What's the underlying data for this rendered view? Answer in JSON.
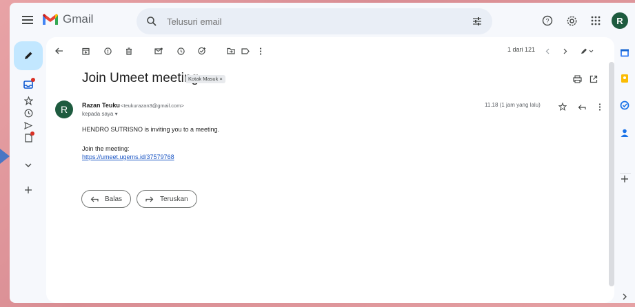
{
  "app": {
    "name": "Gmail",
    "avatar_letter": "R"
  },
  "search": {
    "placeholder": "Telusuri email"
  },
  "toolbar": {
    "pager": "1 dari 121"
  },
  "email": {
    "subject": "Join Umeet meeting",
    "label": "Kotak Masuk ×",
    "sender_name": "Razan Teuku",
    "sender_email": "<teukurazan3@gmail.com>",
    "sender_initial": "R",
    "to": "kepada saya ▾",
    "time": "11.18 (1 jam yang lalu)",
    "body_line1": "HENDRO  SUTRISNO is inviting you to a meeting.",
    "body_line2": "Join the meeting:",
    "link": "https://umeet.ugems.id/37579768"
  },
  "actions": {
    "reply": "Balas",
    "forward": "Teruskan"
  },
  "colors": {
    "accent": "#c2e7ff",
    "avatar": "#1e5b3f",
    "link": "#1a55c4",
    "badge": "#d93025"
  },
  "icons": {
    "nav": [
      "inbox-icon",
      "star-icon",
      "clock-icon",
      "send-icon",
      "draft-icon",
      "chevron-down-icon",
      "plus-icon"
    ],
    "side": [
      "calendar-icon",
      "keep-icon",
      "tasks-icon",
      "contacts-icon",
      "plus-icon",
      "chevron-right-icon"
    ]
  }
}
